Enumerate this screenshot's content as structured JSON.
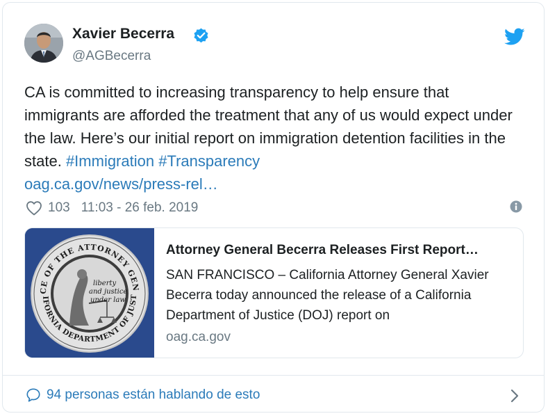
{
  "author": {
    "name": "Xavier Becerra",
    "handle": "@AGBecerra",
    "avatar_icon": "person-avatar"
  },
  "tweet": {
    "text": "CA is committed to increasing transparency to help ensure that immigrants are afforded the treatment that any of us would expect under the law. Here’s our initial report on immigration detention facilities in the state.",
    "hashtags": [
      "#Immigration",
      "#Transparency"
    ],
    "link": "oag.ca.gov/news/press-rel…"
  },
  "meta": {
    "likes": "103",
    "timestamp": "11:03 - 26 feb. 2019"
  },
  "card": {
    "title": "Attorney General Becerra Releases First Report…",
    "description": "SAN FRANCISCO – California Attorney General Xavier Becerra today announced the release of a California Department of Justice (DOJ) report on",
    "domain": "oag.ca.gov",
    "seal": {
      "top_text": "OFFICE OF THE ATTORNEY GENERAL",
      "bottom_text": "CALIFORNIA DEPARTMENT OF JUSTICE",
      "motto_line1": "liberty",
      "motto_line2": "and justice",
      "motto_line3": "under law"
    }
  },
  "footer": {
    "conversation": "94 personas están hablando de esto"
  },
  "colors": {
    "text": "#1c2022",
    "muted": "#697882",
    "link": "#2b7bb9",
    "twitter_blue": "#1da1f2",
    "border": "#e1e8ed",
    "seal_navy": "#2a4a8d"
  }
}
